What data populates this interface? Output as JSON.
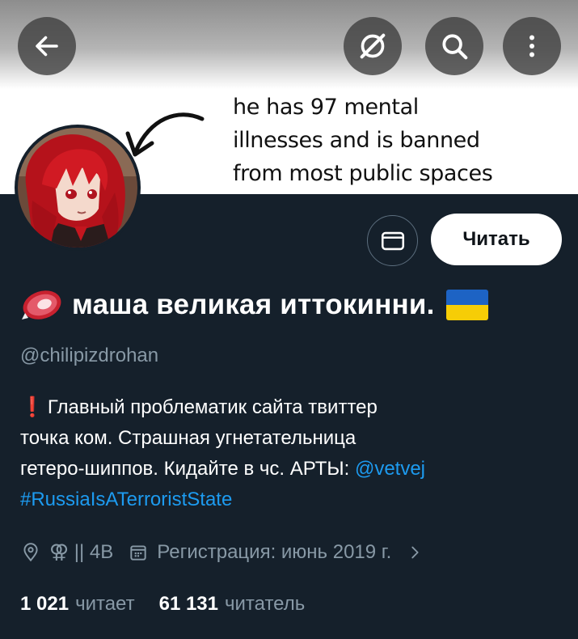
{
  "banner": {
    "caption_lines": [
      "he has 97 mental",
      "illnesses and is banned",
      "from most public spaces"
    ]
  },
  "header_actions": {
    "back_icon": "arrow-left-icon",
    "grok_icon": "grok-icon",
    "search_icon": "search-icon",
    "more_icon": "more-vertical-icon"
  },
  "profile": {
    "display_name": "маша великая иттокинни.",
    "name_emoji": "meat-emoji",
    "name_flag": "ukraine-flag",
    "handle": "@chilipizdrohan",
    "follow_label": "Читать",
    "bio": {
      "exclamation": "❗",
      "line1": "Главный проблематик сайта твиттер",
      "line2": "точка ком. Страшная угнетательница",
      "line3_text": "гетеро-шиппов. Кидайте в чс. АРТЫ: ",
      "line3_link": "@vetvej",
      "hashtag": "#RussiaIsATerroristState"
    },
    "location": "⚢ || 4В",
    "joined": "Регистрация: июнь 2019 г.",
    "following_count": "1 021",
    "following_label": "читает",
    "followers_count": "61 131",
    "followers_label": "читатель"
  },
  "colors": {
    "background": "#15202b",
    "link": "#1d9bf0",
    "muted": "#8899a6",
    "flag_blue": "#1d63c4",
    "flag_yellow": "#f6cd06"
  }
}
